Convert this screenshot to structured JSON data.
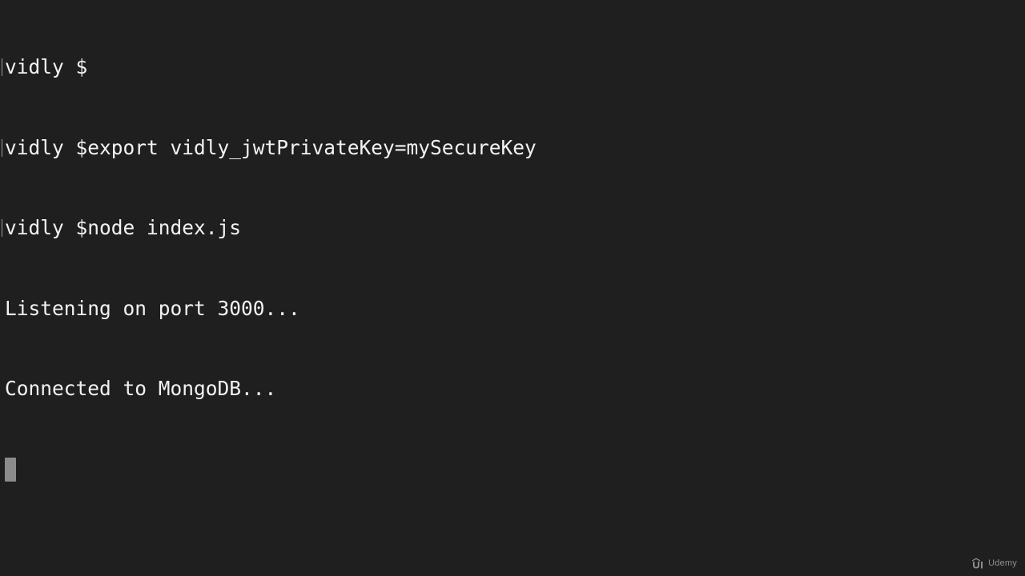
{
  "terminal": {
    "lines": [
      {
        "prompt": "vidly $",
        "command": ""
      },
      {
        "prompt": "vidly $",
        "command": "export vidly_jwtPrivateKey=mySecureKey"
      },
      {
        "prompt": "vidly $",
        "command": "node index.js"
      }
    ],
    "output": [
      "Listening on port 3000...",
      "Connected to MongoDB..."
    ]
  },
  "watermark": {
    "text": "Udemy",
    "icon": "udemy-logo-icon"
  },
  "colors": {
    "background": "#1f1f1f",
    "text": "#f2f2f2",
    "cursor": "#8c8c8c"
  }
}
